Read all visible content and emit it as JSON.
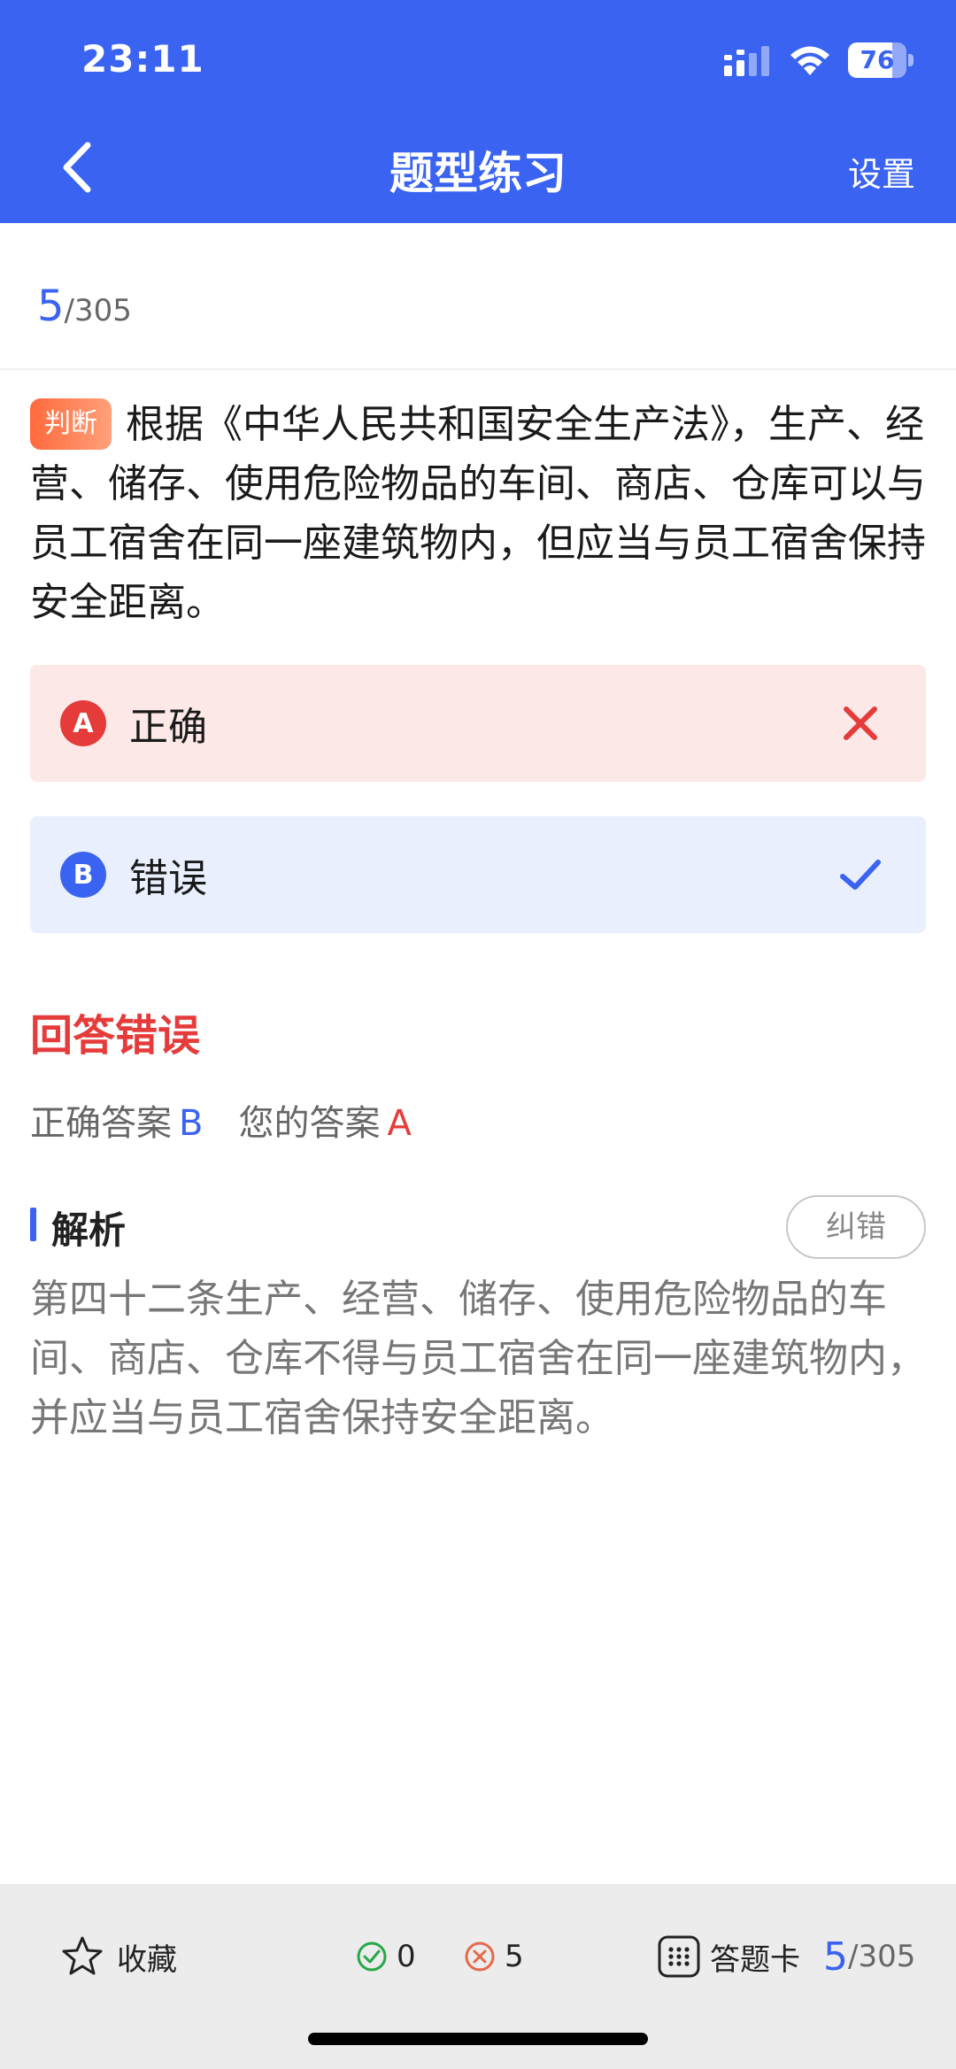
{
  "status_bar": {
    "time": "23:11",
    "battery": "76",
    "battery_level_percent": 76
  },
  "nav": {
    "title": "题型练习",
    "settings_label": "设置"
  },
  "progress": {
    "current": "5",
    "total": "/305"
  },
  "question": {
    "type_label": "判断",
    "text": "根据《中华人民共和国安全生产法》，生产、经营、储存、使用危险物品的车间、商店、仓库可以与员工宿舍在同一座建筑物内，但应当与员工宿舍保持安全距离。"
  },
  "options": [
    {
      "letter": "A",
      "text": "正确",
      "mark_icon": "cross-icon",
      "state": "wrong"
    },
    {
      "letter": "B",
      "text": "错误",
      "mark_icon": "check-icon",
      "state": "correct"
    }
  ],
  "result": {
    "title": "回答错误",
    "correct_label": "正确答案",
    "correct_value": "B",
    "yours_label": "您的答案",
    "yours_value": "A"
  },
  "analysis": {
    "title": "解析",
    "report_button": "纠错",
    "text": "第四十二条生产、经营、储存、使用危险物品的车间、商店、仓库不得与员工宿舍在同一座建筑物内，并应当与员工宿舍保持安全距离。"
  },
  "bottom_bar": {
    "favorite_label": "收藏",
    "correct_count": "0",
    "wrong_count": "5",
    "answer_card_label": "答题卡",
    "progress_current": "5",
    "progress_total": "/305"
  },
  "colors": {
    "primary": "#3a63f1",
    "error": "#e63b3b",
    "success": "#27a745",
    "wrong_option_bg": "#fde8e8",
    "correct_option_bg": "#e9effd"
  }
}
